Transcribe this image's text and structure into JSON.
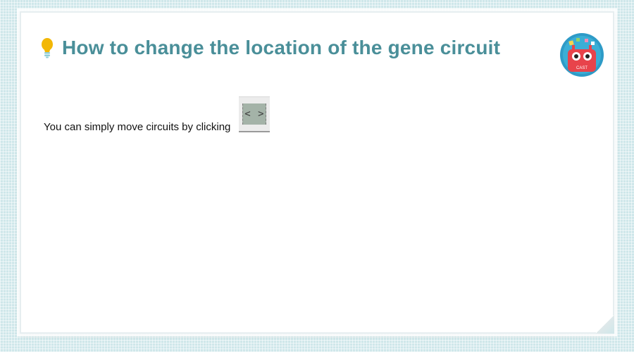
{
  "header": {
    "title": "How to change the location of the gene circuit",
    "icon": "lightbulb-icon",
    "title_color": "#4a8f99"
  },
  "logo": {
    "text": "CAST",
    "icon": "robot-logo-icon",
    "color": "#e8434b"
  },
  "content": {
    "instruction": "You can simply move circuits by clicking",
    "move_button_label": "< >"
  }
}
